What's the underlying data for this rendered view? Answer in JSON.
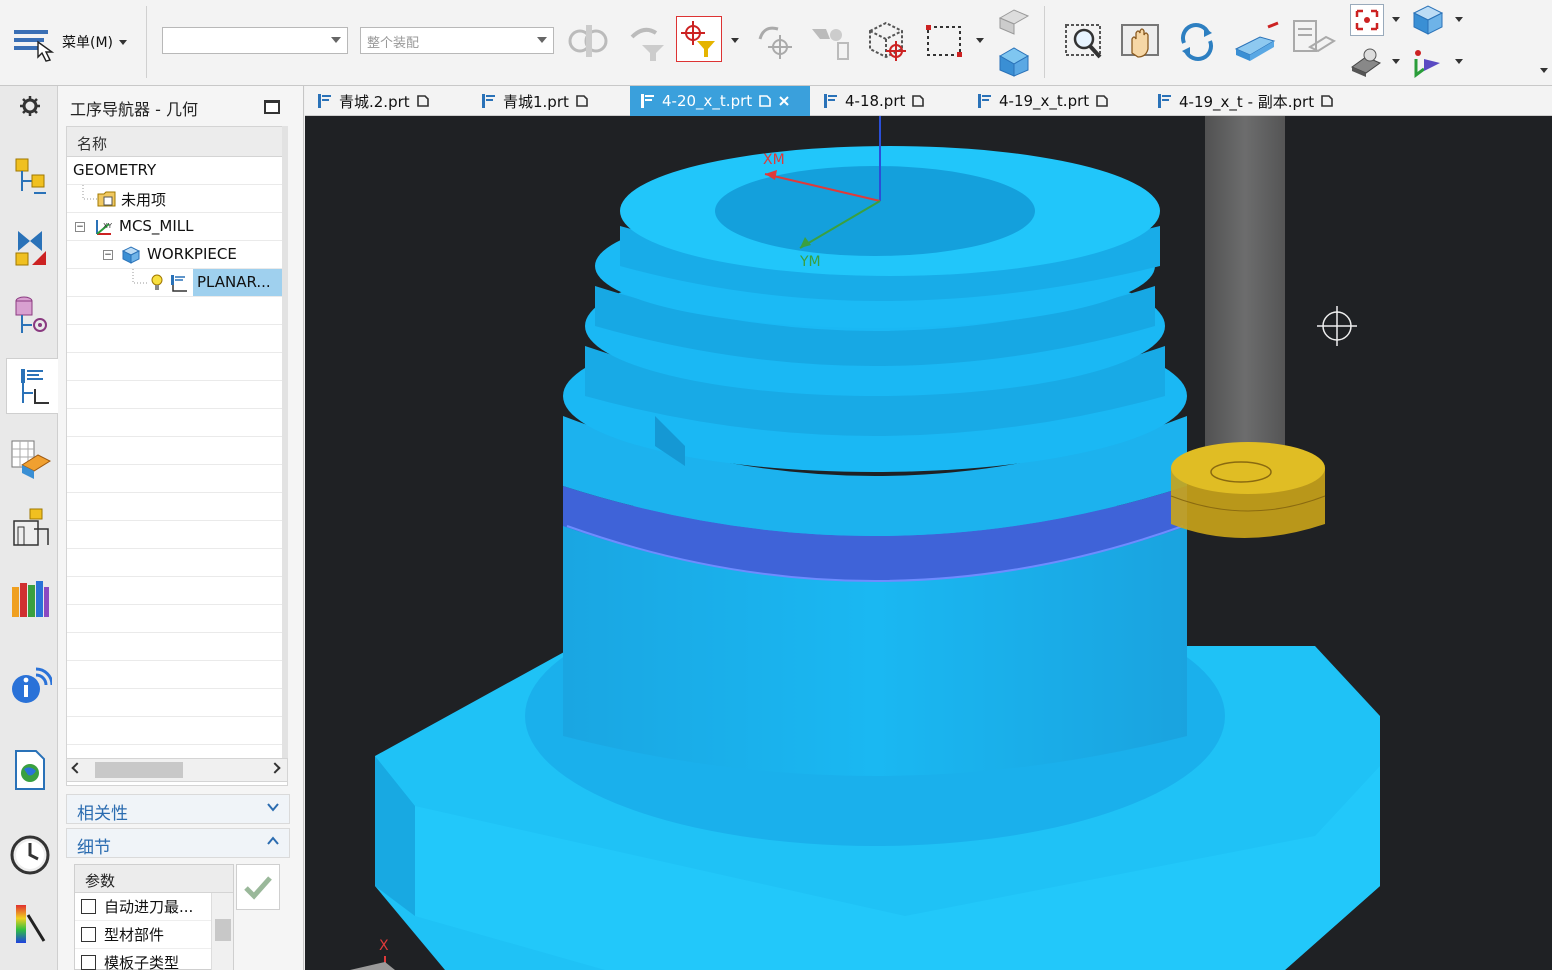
{
  "toolbar": {
    "menu_label": "菜单(M)",
    "filter_value": "",
    "scope_value": "整个装配",
    "icons": [
      "snap-point-icon",
      "undo-filter-icon",
      "selection-filter-icon",
      "rotate-icon",
      "selection-priority-icon",
      "box-select-icon",
      "rectangle-select-icon",
      "view-orient-icon",
      "zoom-window-icon",
      "pan-icon",
      "refresh-icon",
      "shaded-icon",
      "wireframe-icon",
      "fit-icon",
      "view-cube-icon",
      "render-icon",
      "direction-icon"
    ]
  },
  "resource_bar": {
    "items": [
      "settings-icon",
      "operation-navigator-geometry-icon",
      "mirror-icon",
      "machine-tool-icon",
      "program-order-icon",
      "feature-icon",
      "setup-icon",
      "library-icon",
      "info-icon",
      "web-icon",
      "history-icon",
      "palette-icon"
    ]
  },
  "navigator": {
    "title": "工序导航器 - 几何",
    "column_name": "名称",
    "tree": [
      {
        "label": "GEOMETRY",
        "icon": ""
      },
      {
        "label": "未用项",
        "icon": "folder-icon"
      },
      {
        "label": "MCS_MILL",
        "icon": "mcs-icon"
      },
      {
        "label": "WORKPIECE",
        "icon": "workpiece-icon"
      },
      {
        "label": "PLANAR...",
        "icon": "planar-mill-icon"
      }
    ],
    "dependencies_label": "相关性",
    "details_label": "细节",
    "params_header": "参数",
    "params": [
      "自动进刀最...",
      "型材部件",
      "模板子类型"
    ]
  },
  "tabs": [
    {
      "label": "青城.2.prt",
      "active": false
    },
    {
      "label": "青城1.prt",
      "active": false
    },
    {
      "label": "4-20_x_t.prt",
      "active": true
    },
    {
      "label": "4-18.prt",
      "active": false
    },
    {
      "label": "4-19_x_t.prt",
      "active": false
    },
    {
      "label": "4-19_x_t - 副本.prt",
      "active": false
    }
  ],
  "viewport": {
    "axis_xm": "XM",
    "axis_ym": "YM",
    "axis_x": "X",
    "colors": {
      "part": "#18b4ee",
      "groove": "#3f63d8",
      "tool": "#d7b21c",
      "bg": "#1f2124"
    }
  }
}
